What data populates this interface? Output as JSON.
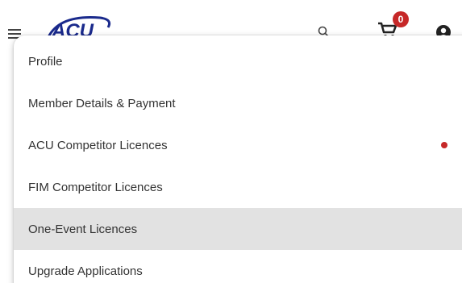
{
  "header": {
    "logo_text": "ACU",
    "cart_count": "0",
    "brand_color": "#1a2a8c",
    "badge_color": "#c62828"
  },
  "menu": {
    "items": [
      {
        "label": "Profile"
      },
      {
        "label": "Member Details & Payment"
      },
      {
        "label": "ACU Competitor Licences",
        "has_notification_dot": true
      },
      {
        "label": "FIM Competitor Licences"
      },
      {
        "label": "One-Event Licences",
        "active": true
      },
      {
        "label": "Upgrade Applications"
      }
    ],
    "active_background": "#e2e2e2"
  }
}
